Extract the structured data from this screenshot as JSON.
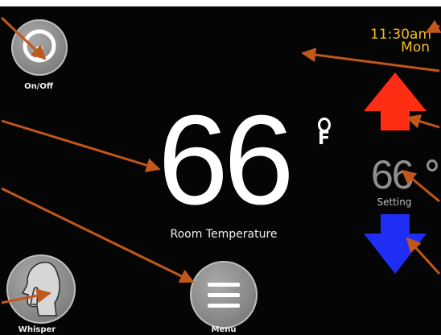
{
  "clock": {
    "time": "11:30am",
    "day": "Mon"
  },
  "onoff": {
    "label": "On/Off",
    "icon": "power-icon"
  },
  "room": {
    "temperature": "66",
    "unit_degree": "O",
    "unit": "F",
    "label": "Room Temperature"
  },
  "setting": {
    "temperature": "66",
    "label": "Setting"
  },
  "controls": {
    "up_icon": "up-arrow-icon",
    "down_icon": "down-arrow-icon"
  },
  "menu": {
    "label": "Menu",
    "icon": "menu-icon"
  },
  "whisper": {
    "label": "Whisper",
    "icon": "whisper-icon"
  },
  "colors": {
    "background": "#050505",
    "clock": "#f2bd1d",
    "up_arrow": "#ff2d14",
    "down_arrow": "#1f2ef5",
    "button": "#8a8a8a",
    "annotation_arrow": "#c2571a"
  }
}
